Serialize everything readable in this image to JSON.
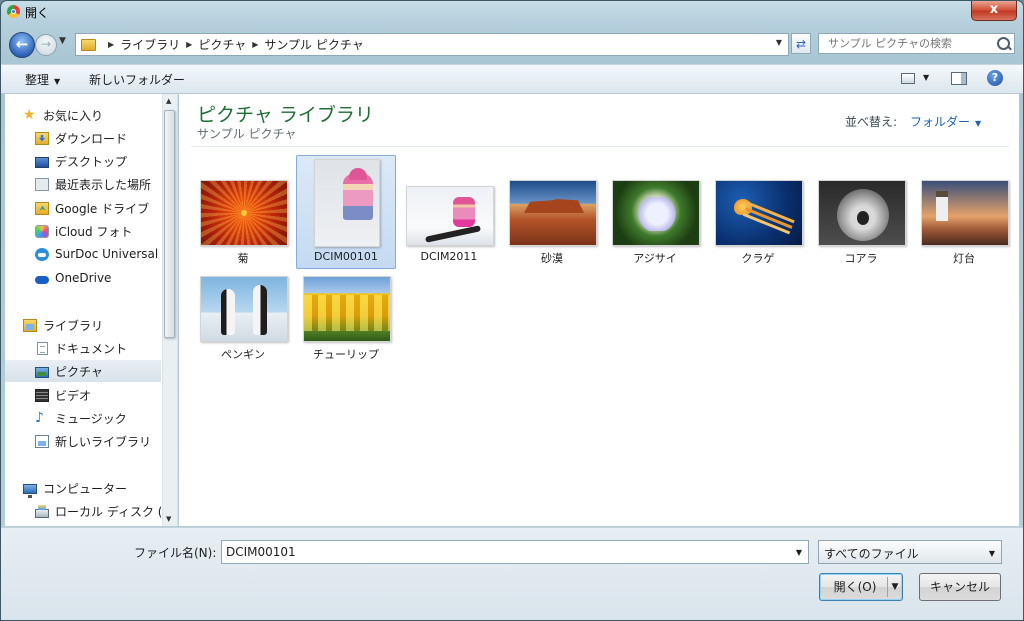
{
  "window": {
    "title": "開く",
    "close_label": "x"
  },
  "address": {
    "crumbs": [
      "ライブラリ",
      "ピクチャ",
      "サンプル ピクチャ"
    ],
    "search_placeholder": "サンプル ピクチャの検索"
  },
  "toolbar": {
    "organize": "整理",
    "new_folder": "新しいフォルダー",
    "help": "?"
  },
  "nav": {
    "items": [
      {
        "label": "お気に入り",
        "icon": "star-icon"
      },
      {
        "label": "ダウンロード",
        "icon": "download-folder-icon"
      },
      {
        "label": "デスクトップ",
        "icon": "desktop-icon"
      },
      {
        "label": "最近表示した場所",
        "icon": "recent-places-icon"
      },
      {
        "label": "Google ドライブ",
        "icon": "google-drive-icon"
      },
      {
        "label": "iCloud フォト",
        "icon": "icloud-photos-icon"
      },
      {
        "label": "SurDoc Universal S",
        "icon": "surdoc-icon"
      },
      {
        "label": "OneDrive",
        "icon": "onedrive-icon"
      },
      {
        "label": "ライブラリ",
        "icon": "library-icon"
      },
      {
        "label": "ドキュメント",
        "icon": "documents-icon"
      },
      {
        "label": "ピクチャ",
        "icon": "pictures-icon"
      },
      {
        "label": "ビデオ",
        "icon": "videos-icon"
      },
      {
        "label": "ミュージック",
        "icon": "music-icon"
      },
      {
        "label": "新しいライブラリ",
        "icon": "new-library-icon"
      },
      {
        "label": "コンピューター",
        "icon": "computer-icon"
      },
      {
        "label": "ローカル ディスク (",
        "icon": "local-disk-icon"
      }
    ],
    "selected": "ピクチャ"
  },
  "content": {
    "title": "ピクチャ ライブラリ",
    "subtitle": "サンプル ピクチャ",
    "sort_label": "並べ替え:",
    "sort_value": "フォルダー",
    "files": [
      {
        "name": "菊"
      },
      {
        "name": "DCIM00101"
      },
      {
        "name": "DCIM2011"
      },
      {
        "name": "砂漠"
      },
      {
        "name": "アジサイ"
      },
      {
        "name": "クラゲ"
      },
      {
        "name": "コアラ"
      },
      {
        "name": "灯台"
      },
      {
        "name": "ペンギン"
      },
      {
        "name": "チューリップ"
      }
    ],
    "selected_file": "DCIM00101"
  },
  "footer": {
    "filename_label": "ファイル名(N):",
    "filename_value": "DCIM00101",
    "filetype": "すべてのファイル",
    "open_label": "開く(O)",
    "cancel_label": "キャンセル"
  }
}
